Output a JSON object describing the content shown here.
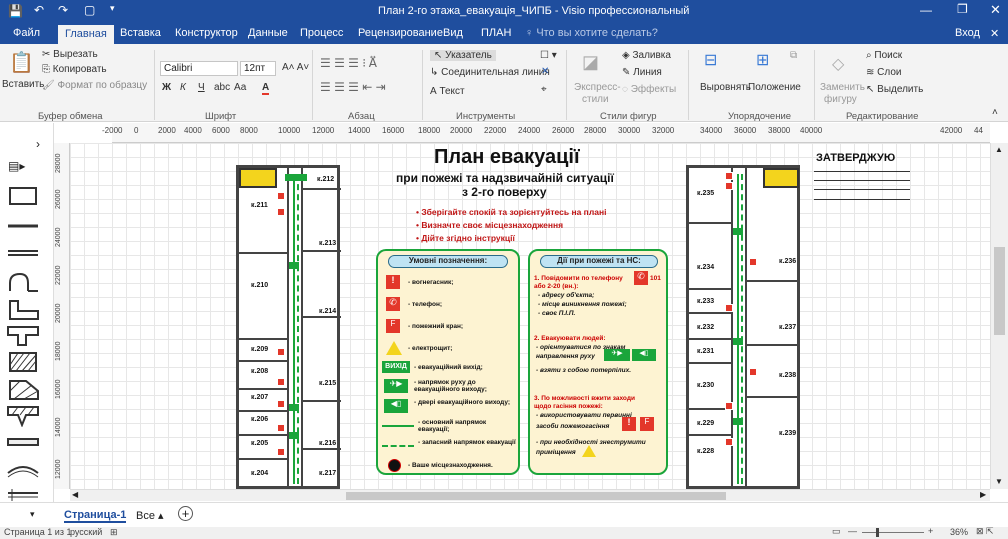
{
  "window": {
    "title": "План 2-го этажа_евакуація_ЧИПБ - Visio профессиональный"
  },
  "tabs": [
    "Файл",
    "Главная",
    "Вставка",
    "Конструктор",
    "Данные",
    "Процесс",
    "Рецензирование",
    "Вид",
    "ПЛАН"
  ],
  "tell_me": "Что вы хотите сделать?",
  "signin": "Вход",
  "ribbon": {
    "paste": "Вставить",
    "cut": "Вырезать",
    "copy": "Копировать",
    "format_painter": "Формат по образцу",
    "clipboard_group": "Буфер обмена",
    "font_name": "Calibri",
    "font_size": "12пт",
    "bold": "Ж",
    "italic": "К",
    "underline": "Ч",
    "strike": "abc",
    "case": "Аа",
    "font_color": "А",
    "font_group": "Шрифт",
    "para_group": "Абзац",
    "pointer": "Указатель",
    "connector": "Соединительная линия",
    "text": "А Текст",
    "tools_group": "Инструменты",
    "express": "Экспресс-",
    "styles": "стили",
    "fill": "Заливка",
    "line": "Линия",
    "effects": "Эффекты",
    "styles_group": "Стили фигур",
    "align": "Выровнять",
    "position": "Положение",
    "arrange_group": "Упорядочение",
    "replace": "Заменить",
    "shape_word": "фигуру",
    "find": "Поиск",
    "layers": "Слои",
    "select": "Выделить",
    "editing_group": "Редактирование"
  },
  "ruler_ticks": [
    "-2000",
    "0",
    "2000",
    "4000",
    "6000",
    "8000",
    "10000",
    "12000",
    "14000",
    "16000",
    "18000",
    "20000",
    "22000",
    "24000",
    "26000",
    "28000",
    "30000",
    "32000",
    "34000",
    "36000",
    "38000",
    "40000",
    "42000",
    "44"
  ],
  "vruler_ticks": [
    "28000",
    "26000",
    "24000",
    "22000",
    "20000",
    "18000",
    "16000",
    "14000",
    "12000"
  ],
  "plan": {
    "title": "План евакуації",
    "subtitle1": "при пожежі та надзвичайній ситуації",
    "subtitle2": "з 2-го поверху",
    "approve": "ЗАТВЕРДЖУЮ",
    "bullets": [
      "Зберігайте спокій та зорієнтуйтесь на плані",
      "Визначте своє місцезнаходження",
      "Дійте згідно інструкції"
    ],
    "rooms_left": [
      "к.212",
      "к.211",
      "к.213",
      "к.210",
      "к.214",
      "к.209",
      "к.208",
      "к.215",
      "к.207",
      "к.206",
      "к.205",
      "к.216",
      "к.204",
      "к.217"
    ],
    "rooms_right": [
      "к.235",
      "к.236",
      "к.234",
      "к.233",
      "к.232",
      "к.237",
      "к.231",
      "к.230",
      "к.238",
      "к.229",
      "к.228",
      "к.239"
    ],
    "legend_title": "Умовні позначення:",
    "legend": [
      "- вогнегасник;",
      "- телефон;",
      "- пожежний кран;",
      "- електрощит;",
      "- евакуаційний вихід;",
      "- напрямок руху до евакуаційного виходу;",
      "- двері евакуаційного виходу;",
      "- основний напрямок евакуації;",
      "- запасний напрямок евакуації",
      "- Ваше місцезнаходження."
    ],
    "exit_word": "ВИХІД",
    "actions_title": "Дії при пожежі та НС:",
    "act1": "1. Повідомити по телефону",
    "act1_num": "101",
    "act1b": "або 2-20 (вн.):",
    "act1_items": [
      "- адресу об'єкта;",
      "- місце виникнення пожежі;",
      "- своє П.І.П."
    ],
    "act2": "2. Евакуювати людей:",
    "act2_items": [
      "- орієнтуватися по знакам",
      "направлення руху",
      "- взяти з собою потерпілих."
    ],
    "act3a": "3. По можливості вжити заходи",
    "act3b": "щодо гасіння пожежі:",
    "act3_items": [
      "- використовувати первинні",
      "засоби пожежогасіння",
      "- при необхідності знеструмити",
      "приміщення"
    ]
  },
  "pages": {
    "page1": "Страница-1",
    "all": "Все",
    "add": "+"
  },
  "status": {
    "page": "Страница 1 из 1",
    "lang": "русский",
    "zoom": "36%"
  },
  "colors": {
    "accent": "#1f4e9e",
    "green": "#1aa53b",
    "red": "#e3372a"
  }
}
